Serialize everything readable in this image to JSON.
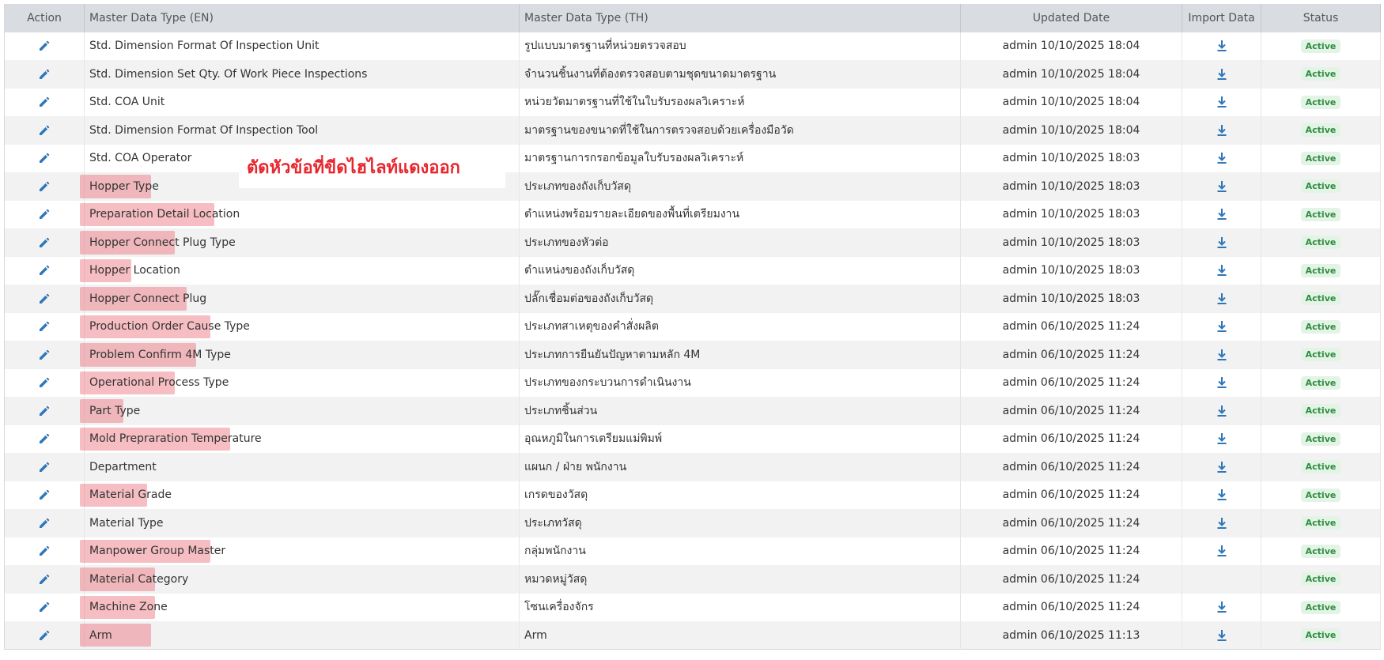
{
  "headers": {
    "action": "Action",
    "en": "Master Data Type (EN)",
    "th": "Master Data Type (TH)",
    "updated": "Updated Date",
    "import": "Import Data",
    "status": "Status"
  },
  "annotation": "ตัดหัวข้อที่ขีดไฮไลท์แดงออก",
  "colors": {
    "accent": "#2f77b8",
    "highlight": "#eb6e78",
    "annotation": "#e8262d",
    "status_bg": "#e3f4e6",
    "status_fg": "#2e8b3e"
  },
  "rows": [
    {
      "en": "Std. Dimension Format Of Inspection Unit",
      "th": "รูปแบบมาตรฐานที่หน่วยตรวจสอบ",
      "date": "admin 10/10/2025 18:04",
      "status": "Active",
      "import": true,
      "highlighted": false
    },
    {
      "en": "Std. Dimension Set Qty. Of Work Piece Inspections",
      "th": "จำนวนชิ้นงานที่ต้องตรวจสอบตามชุดขนาดมาตรฐาน",
      "date": "admin 10/10/2025 18:04",
      "status": "Active",
      "import": true,
      "highlighted": false
    },
    {
      "en": "Std. COA Unit",
      "th": "หน่วยวัดมาตรฐานที่ใช้ในใบรับรองผลวิเคราะห์",
      "date": "admin 10/10/2025 18:04",
      "status": "Active",
      "import": true,
      "highlighted": false
    },
    {
      "en": "Std. Dimension Format Of Inspection Tool",
      "th": "มาตรฐานของขนาดที่ใช้ในการตรวจสอบด้วยเครื่องมือวัด",
      "date": "admin 10/10/2025 18:04",
      "status": "Active",
      "import": true,
      "highlighted": false
    },
    {
      "en": "Std. COA Operator",
      "th": "มาตรฐานการกรอกข้อมูลใบรับรองผลวิเคราะห์",
      "date": "admin 10/10/2025 18:03",
      "status": "Active",
      "import": true,
      "highlighted": false
    },
    {
      "en": "Hopper Type",
      "th": "ประเภทของถังเก็บวัสดุ",
      "date": "admin 10/10/2025 18:03",
      "status": "Active",
      "import": true,
      "highlighted": true
    },
    {
      "en": "Preparation Detail Location",
      "th": "ตำแหน่งพร้อมรายละเอียดของพื้นที่เตรียมงาน",
      "date": "admin 10/10/2025 18:03",
      "status": "Active",
      "import": true,
      "highlighted": true
    },
    {
      "en": "Hopper Connect Plug Type",
      "th": "ประเภทของหัวต่อ",
      "date": "admin 10/10/2025 18:03",
      "status": "Active",
      "import": true,
      "highlighted": true
    },
    {
      "en": "Hopper Location",
      "th": "ตำแหน่งของถังเก็บวัสดุ",
      "date": "admin 10/10/2025 18:03",
      "status": "Active",
      "import": true,
      "highlighted": true
    },
    {
      "en": "Hopper Connect Plug",
      "th": "ปลั๊กเชื่อมต่อของถังเก็บวัสดุ",
      "date": "admin 10/10/2025 18:03",
      "status": "Active",
      "import": true,
      "highlighted": true
    },
    {
      "en": "Production Order Cause Type",
      "th": "ประเภทสาเหตุของคำสั่งผลิต",
      "date": "admin 06/10/2025 11:24",
      "status": "Active",
      "import": true,
      "highlighted": true
    },
    {
      "en": "Problem Confirm 4M Type",
      "th": "ประเภทการยืนยันปัญหาตามหลัก 4M",
      "date": "admin 06/10/2025 11:24",
      "status": "Active",
      "import": true,
      "highlighted": true
    },
    {
      "en": "Operational Process Type",
      "th": "ประเภทของกระบวนการดำเนินงาน",
      "date": "admin 06/10/2025 11:24",
      "status": "Active",
      "import": true,
      "highlighted": true
    },
    {
      "en": "Part Type",
      "th": "ประเภทชิ้นส่วน",
      "date": "admin 06/10/2025 11:24",
      "status": "Active",
      "import": true,
      "highlighted": true
    },
    {
      "en": "Mold Prepraration Temperature",
      "th": "อุณหภูมิในการเตรียมแม่พิมพ์",
      "date": "admin 06/10/2025 11:24",
      "status": "Active",
      "import": true,
      "highlighted": true
    },
    {
      "en": "Department",
      "th": "แผนก / ฝ่าย พนักงาน",
      "date": "admin 06/10/2025 11:24",
      "status": "Active",
      "import": true,
      "highlighted": false
    },
    {
      "en": "Material Grade",
      "th": "เกรดของวัสดุ",
      "date": "admin 06/10/2025 11:24",
      "status": "Active",
      "import": true,
      "highlighted": true
    },
    {
      "en": "Material Type",
      "th": "ประเภทวัสดุ",
      "date": "admin 06/10/2025 11:24",
      "status": "Active",
      "import": true,
      "highlighted": false
    },
    {
      "en": "Manpower Group Master",
      "th": "กลุ่มพนักงาน",
      "date": "admin 06/10/2025 11:24",
      "status": "Active",
      "import": true,
      "highlighted": true
    },
    {
      "en": "Material Category",
      "th": "หมวดหมู่วัสดุ",
      "date": "admin 06/10/2025 11:24",
      "status": "Active",
      "import": false,
      "highlighted": true
    },
    {
      "en": "Machine Zone",
      "th": "โซนเครื่องจักร",
      "date": "admin 06/10/2025 11:24",
      "status": "Active",
      "import": true,
      "highlighted": true
    },
    {
      "en": "Arm",
      "th": "Arm",
      "date": "admin 06/10/2025 11:13",
      "status": "Active",
      "import": true,
      "highlighted": true
    }
  ]
}
